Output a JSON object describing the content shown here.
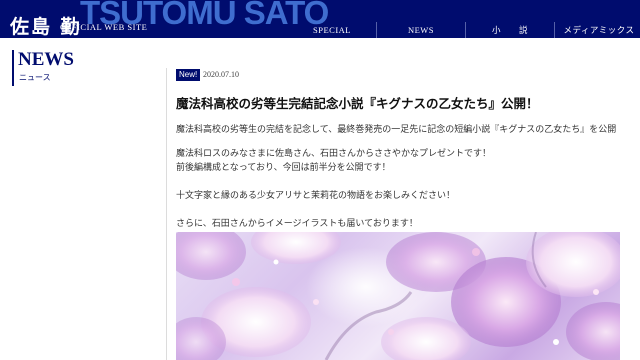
{
  "header": {
    "logo_bg": "TSUTOMU SATO",
    "logo_name": "佐島 勤",
    "logo_sub": "OFFICIAL WEB SITE",
    "nav": [
      "SPECIAL",
      "NEWS",
      "小　　説",
      "メディアミックス"
    ],
    "bg_color": "#000c6e"
  },
  "section": {
    "title": "NEWS",
    "subtitle": "ニュース"
  },
  "article": {
    "badge": "New!",
    "date": "2020.07.10",
    "title": "魔法科高校の劣等生完結記念小説『キグナスの乙女たち』公開！",
    "body": [
      "魔法科高校の劣等生の完結を記念して、最終巻発売の一足先に記念の短編小説『キグナスの乙女たち』を公開",
      "魔法科ロスのみなさまに佐島さん、石田さんからささやかなプレゼントです！",
      "前後編構成となっており、今回は前半分を公開です！",
      "十文字家と縁のある少女アリサと茉莉花の物語をお楽しみください！",
      "さらに、石田さんからイメージイラストも届いております！"
    ]
  }
}
